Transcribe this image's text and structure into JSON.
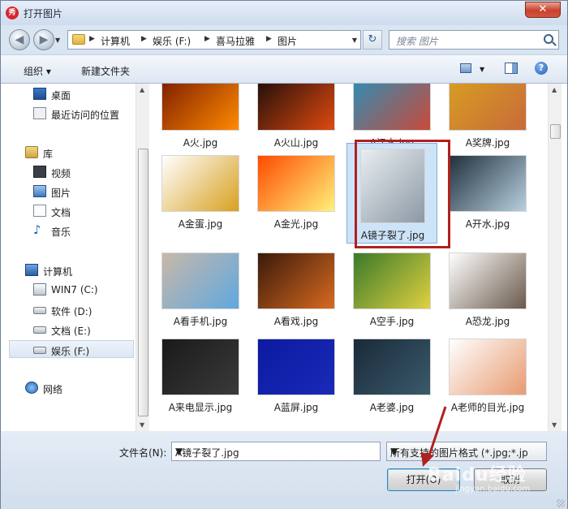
{
  "window": {
    "title": "打开图片",
    "app_icon_text": "秀",
    "close_label": "✕"
  },
  "address": {
    "crumbs": [
      "计算机",
      "娱乐 (F:)",
      "喜马拉雅",
      "图片"
    ],
    "search_placeholder": "搜索 图片"
  },
  "toolbar": {
    "organize_label": "组织 ▾",
    "new_folder_label": "新建文件夹"
  },
  "nav": {
    "items": [
      {
        "label": "桌面",
        "icon": "desktop-icon"
      },
      {
        "label": "最近访问的位置",
        "icon": "recent-places-icon"
      },
      {
        "label": "库",
        "icon": "libraries-icon"
      },
      {
        "label": "视频",
        "icon": "videos-icon"
      },
      {
        "label": "图片",
        "icon": "pictures-icon"
      },
      {
        "label": "文档",
        "icon": "documents-icon"
      },
      {
        "label": "音乐",
        "icon": "music-icon"
      },
      {
        "label": "计算机",
        "icon": "computer-icon"
      },
      {
        "label": "WIN7 (C:)",
        "icon": "system-drive-icon"
      },
      {
        "label": "软件 (D:)",
        "icon": "drive-icon"
      },
      {
        "label": "文档 (E:)",
        "icon": "drive-icon"
      },
      {
        "label": "娱乐 (F:)",
        "icon": "drive-icon",
        "selected": true
      },
      {
        "label": "网络",
        "icon": "network-icon"
      }
    ]
  },
  "files": [
    {
      "name": "A火.jpg",
      "colors": [
        "#7a1a00",
        "#ff8a00"
      ]
    },
    {
      "name": "A火山.jpg",
      "colors": [
        "#1a0c0a",
        "#e04a10"
      ]
    },
    {
      "name": "A江水.jpg",
      "colors": [
        "#2a8fb8",
        "#c94a3a"
      ]
    },
    {
      "name": "A奖牌.jpg",
      "colors": [
        "#d8a020",
        "#c86a3a"
      ]
    },
    {
      "name": "A金蛋.jpg",
      "colors": [
        "#ffffff",
        "#d8a020"
      ]
    },
    {
      "name": "A金光.jpg",
      "colors": [
        "#ff4a00",
        "#fff27a"
      ]
    },
    {
      "name": "A镜子裂了.jpg",
      "colors": [
        "#e9eef2",
        "#8c98a4"
      ],
      "selected": true
    },
    {
      "name": "A开水.jpg",
      "colors": [
        "#20303c",
        "#b8d0e0"
      ]
    },
    {
      "name": "A看手机.jpg",
      "colors": [
        "#c8b8a8",
        "#5fa8e0"
      ]
    },
    {
      "name": "A看戏.jpg",
      "colors": [
        "#3a1a0a",
        "#d86a20"
      ]
    },
    {
      "name": "A空手.jpg",
      "colors": [
        "#3a7a2a",
        "#e0d040"
      ]
    },
    {
      "name": "A恐龙.jpg",
      "colors": [
        "#ffffff",
        "#6a5a4a"
      ]
    },
    {
      "name": "A来电显示.jpg",
      "colors": [
        "#1a1a1a",
        "#3a3a3a"
      ]
    },
    {
      "name": "A蓝屏.jpg",
      "colors": [
        "#0c1aa0",
        "#1a2ab8"
      ]
    },
    {
      "name": "A老婆.jpg",
      "colors": [
        "#1a2a3a",
        "#3a5a6a"
      ]
    },
    {
      "name": "A老师的目光.jpg",
      "colors": [
        "#ffffff",
        "#e89a70"
      ]
    }
  ],
  "bottom": {
    "filename_label": "文件名(N):",
    "filename_value": "A镜子裂了.jpg",
    "filetype_value": "所有支持的图片格式 (*.jpg;*.jp",
    "open_label": "打开(O)",
    "cancel_label": "取消"
  },
  "watermark": {
    "text": "Baidu经验",
    "sub": "jingyan.baidu.com"
  },
  "colors": {
    "annotation": "#b0201f",
    "selection": "#cde3f8"
  }
}
